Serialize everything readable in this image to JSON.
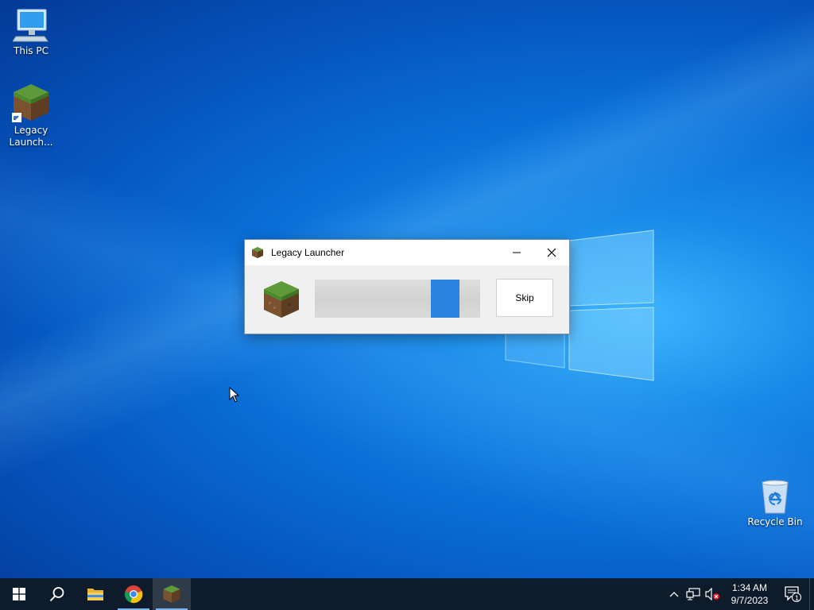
{
  "desktop": {
    "icons": [
      {
        "label": "This PC"
      },
      {
        "label": "Legacy Launch..."
      },
      {
        "label": "Recycle Bin"
      }
    ]
  },
  "dialog": {
    "title": "Legacy Launcher",
    "skip_label": "Skip",
    "progress_indeterminate": true,
    "colors": {
      "accent": "#2b83e0"
    }
  },
  "taskbar": {
    "apps": [
      {
        "name": "start-icon"
      },
      {
        "name": "search-icon"
      },
      {
        "name": "file-explorer-icon"
      },
      {
        "name": "chrome-icon"
      },
      {
        "name": "legacy-launcher-icon"
      }
    ],
    "clock": {
      "time": "1:34 AM",
      "date": "9/7/2023"
    },
    "notification_count": "1"
  }
}
